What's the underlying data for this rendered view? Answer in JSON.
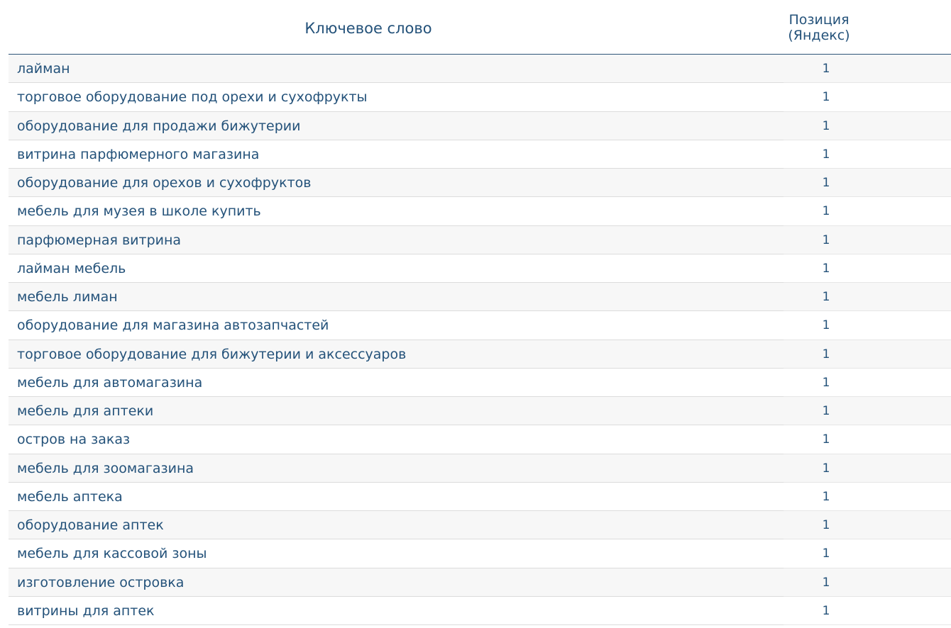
{
  "table": {
    "headers": {
      "keyword": "Ключевое слово",
      "position_line1": "Позиция",
      "position_line2": "(Яндекс)"
    },
    "rows": [
      {
        "keyword": "лайман",
        "position": "1"
      },
      {
        "keyword": "торговое оборудование под орехи и сухофрукты",
        "position": "1"
      },
      {
        "keyword": "оборудование для продажи бижутерии",
        "position": "1"
      },
      {
        "keyword": "витрина парфюмерного магазина",
        "position": "1"
      },
      {
        "keyword": "оборудование для орехов и сухофруктов",
        "position": "1"
      },
      {
        "keyword": "мебель для музея в школе купить",
        "position": "1"
      },
      {
        "keyword": "парфюмерная витрина",
        "position": "1"
      },
      {
        "keyword": "лайман мебель",
        "position": "1"
      },
      {
        "keyword": "мебель лиман",
        "position": "1"
      },
      {
        "keyword": "оборудование для магазина автозапчастей",
        "position": "1"
      },
      {
        "keyword": "торговое оборудование для бижутерии и аксессуаров",
        "position": "1"
      },
      {
        "keyword": "мебель для автомагазина",
        "position": "1"
      },
      {
        "keyword": "мебель для аптеки",
        "position": "1"
      },
      {
        "keyword": "остров на заказ",
        "position": "1"
      },
      {
        "keyword": "мебель для зоомагазина",
        "position": "1"
      },
      {
        "keyword": "мебель аптека",
        "position": "1"
      },
      {
        "keyword": "оборудование аптек",
        "position": "1"
      },
      {
        "keyword": "мебель для кассовой зоны",
        "position": "1"
      },
      {
        "keyword": "изготовление островка",
        "position": "1"
      },
      {
        "keyword": "витрины для аптек",
        "position": "1"
      }
    ]
  },
  "colors": {
    "text": "#24527a",
    "header_rule": "#2f5578",
    "row_stripe": "#f7f7f7",
    "row_divider": "#dcdcdc"
  }
}
